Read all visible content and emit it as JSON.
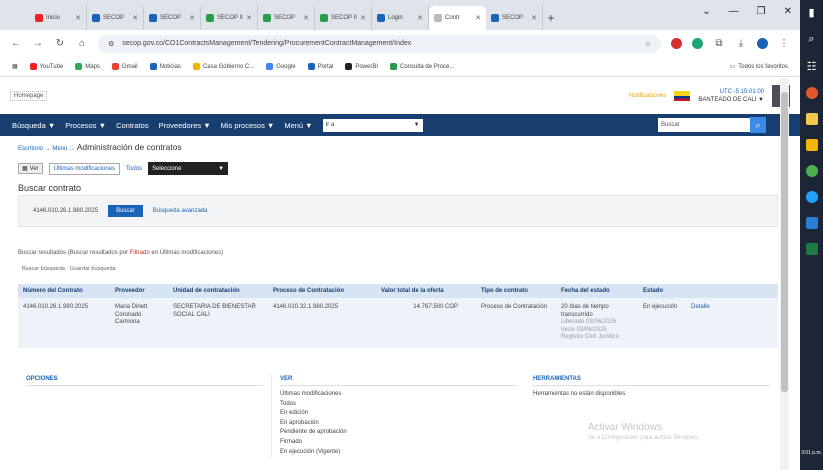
{
  "browser": {
    "tabs": [
      {
        "label": "Inicio"
      },
      {
        "label": "SECOP"
      },
      {
        "label": "SECOP"
      },
      {
        "label": "SECOP II"
      },
      {
        "label": "SECOP"
      },
      {
        "label": "SECOP II"
      },
      {
        "label": "Login"
      },
      {
        "label": "Contr",
        "active": true
      },
      {
        "label": "SECOP"
      }
    ],
    "url": "secop.gov.co/CO1ContractsManagement/Tendering/ProcurementContractManagement/Index",
    "bookmarks": [
      "YouTube",
      "Maps",
      "Gmail",
      "Noticias",
      "Casa Gobierno C...",
      "Google",
      "Portal",
      "PowerBI",
      "Consulta de Proce..."
    ],
    "bookmarks_right": "Todos los favoritos"
  },
  "header": {
    "logo_alt": "Homepage",
    "notifications": "Notificaciones",
    "timezone": "UTC -5 15:01:00",
    "user": "BANTEADO DE CALI"
  },
  "nav": {
    "items": [
      "Búsqueda ▼",
      "Procesos ▼",
      "Contratos",
      "Proveedores ▼",
      "Mis procesos ▼",
      "Menú ▼"
    ],
    "select_value": "Ir a",
    "search_placeholder": "Buscar"
  },
  "breadcrumb": {
    "path": "Escritorio → Menú → ",
    "title": "Administración de contratos"
  },
  "view": {
    "toggle": "Ver",
    "last_mods": "Últimas modificaciones",
    "all": "Todos",
    "select": "Seleccione"
  },
  "search": {
    "title": "Buscar contrato",
    "value": "4146.010.26.1.980.2025",
    "button": "Buscar",
    "advanced": "Búsqueda avanzada"
  },
  "results": {
    "note_prefix": "Buscar resultados (Buscar resultados por ",
    "note_highlight": "Filtrado",
    "note_suffix": " en Últimas modificaciones)",
    "sub": "Buscar búsqueda · Guardar búsqueda",
    "columns": [
      "Número del Contrato",
      "Proveedor",
      "Unidad de contratación",
      "Proceso de Contratación",
      "Valor total de la oferta",
      "Tipo de contrato",
      "Fecha del estado",
      "Estado",
      ""
    ],
    "rows": [
      {
        "contract": "4146.010.26.1.980.2025",
        "provider": "Maria Dinett Coronado Carmona",
        "unit": "SECRETARIA DE BIENESTAR SOCIAL CALI",
        "process": "4146.010.32.1.980.2025",
        "value": "14.767.500 COP",
        "type": "Proceso de Contratación",
        "date_main": "20 días de tiempo transcurrido",
        "date_sub1": "Liberado 03/06/2025",
        "date_sub2": "Inicio 03/06/2025",
        "date_sub3": "Registro Civil Jurídico",
        "state": "En ejecución",
        "action": "Detalle"
      }
    ]
  },
  "panels": {
    "options": {
      "title": "OPCIONES"
    },
    "ver": {
      "title": "VER",
      "items": [
        "Últimas modificaciones",
        "Todos",
        "En edición",
        "En aprobación",
        "Pendiente de aprobación",
        "Firmado",
        "En ejecución (Vigente)"
      ]
    },
    "tools": {
      "title": "HERRAMIENTAS",
      "note": "Herramientas no están disponibles"
    }
  },
  "watermark": {
    "line1": "Activar Windows",
    "line2": "Ve a Configuración para activar Windows."
  },
  "taskbar": {
    "time": "3:01 p.m."
  }
}
